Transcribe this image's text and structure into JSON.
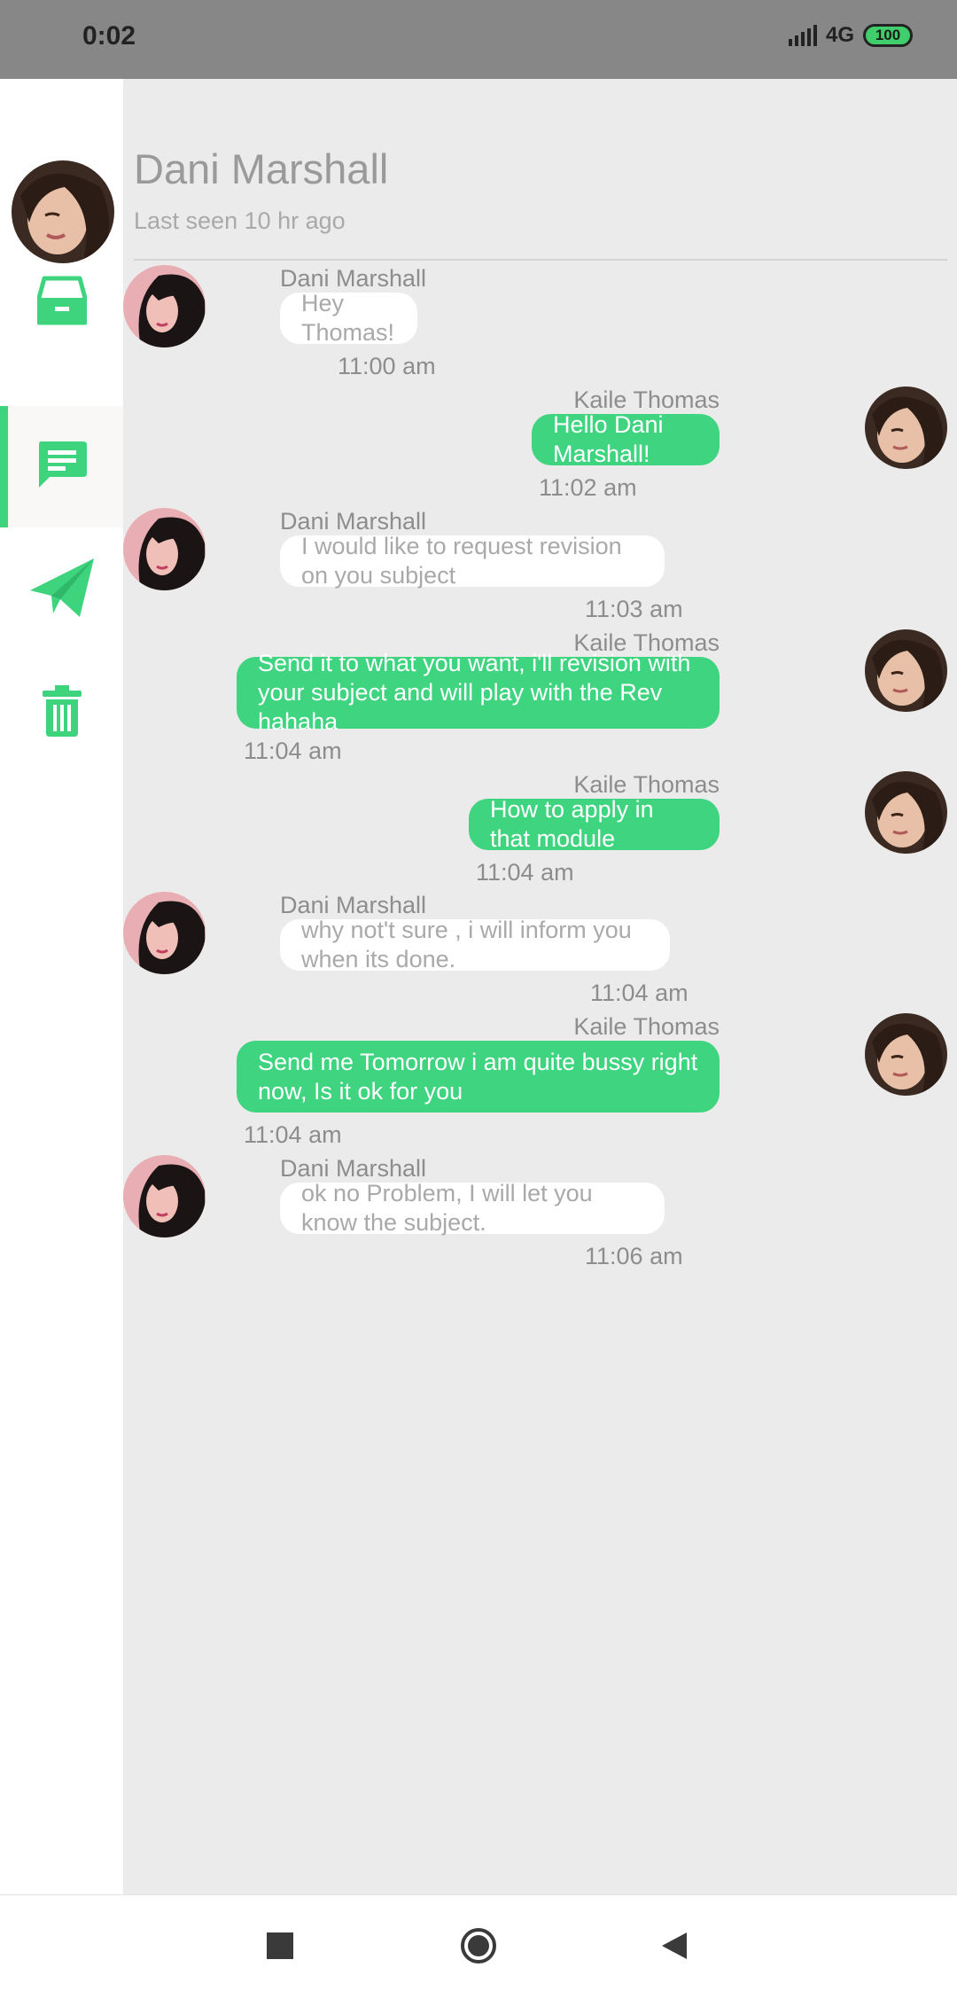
{
  "status_bar": {
    "time": "0:02",
    "network": "4G",
    "battery": "100"
  },
  "sidebar": {
    "items": [
      {
        "name": "inbox-icon",
        "active": false
      },
      {
        "name": "chat-icon",
        "active": true
      },
      {
        "name": "send-icon",
        "active": false
      },
      {
        "name": "trash-icon",
        "active": false
      }
    ]
  },
  "colors": {
    "accent": "#3fd47f",
    "incoming_bubble": "#ffffff",
    "background": "#ebebeb"
  },
  "header": {
    "name": "Dani Marshall",
    "status": "Last seen 10 hr ago"
  },
  "messages": [
    {
      "sender": "Dani Marshall",
      "text": "Hey Thomas!",
      "time": "11:00 am",
      "direction": "in"
    },
    {
      "sender": "Kaile Thomas",
      "text": "Hello Dani Marshall!",
      "time": "11:02 am",
      "direction": "out"
    },
    {
      "sender": "Dani Marshall",
      "text": "I would like to request revision on you subject",
      "time": "11:03 am",
      "direction": "in"
    },
    {
      "sender": "Kaile Thomas",
      "text": "Send it to what you want, i'll revision with your subject and will play with the Rev hahaha",
      "time": "11:04 am",
      "direction": "out"
    },
    {
      "sender": "Kaile Thomas",
      "text": "How to apply in that module",
      "time": "11:04 am",
      "direction": "out"
    },
    {
      "sender": "Dani Marshall",
      "text": "why not't sure , i will inform you when its done.",
      "time": "11:04 am",
      "direction": "in"
    },
    {
      "sender": "Kaile Thomas",
      "text": "Send me Tomorrow i am quite bussy right now, Is it ok for you",
      "time": "11:04 am",
      "direction": "out"
    },
    {
      "sender": "Dani Marshall",
      "text": "ok no Problem, I will let you know the subject.",
      "time": "11:06 am",
      "direction": "in"
    }
  ],
  "nav_bar": {
    "buttons": [
      "recents-button",
      "home-button",
      "back-button"
    ]
  }
}
